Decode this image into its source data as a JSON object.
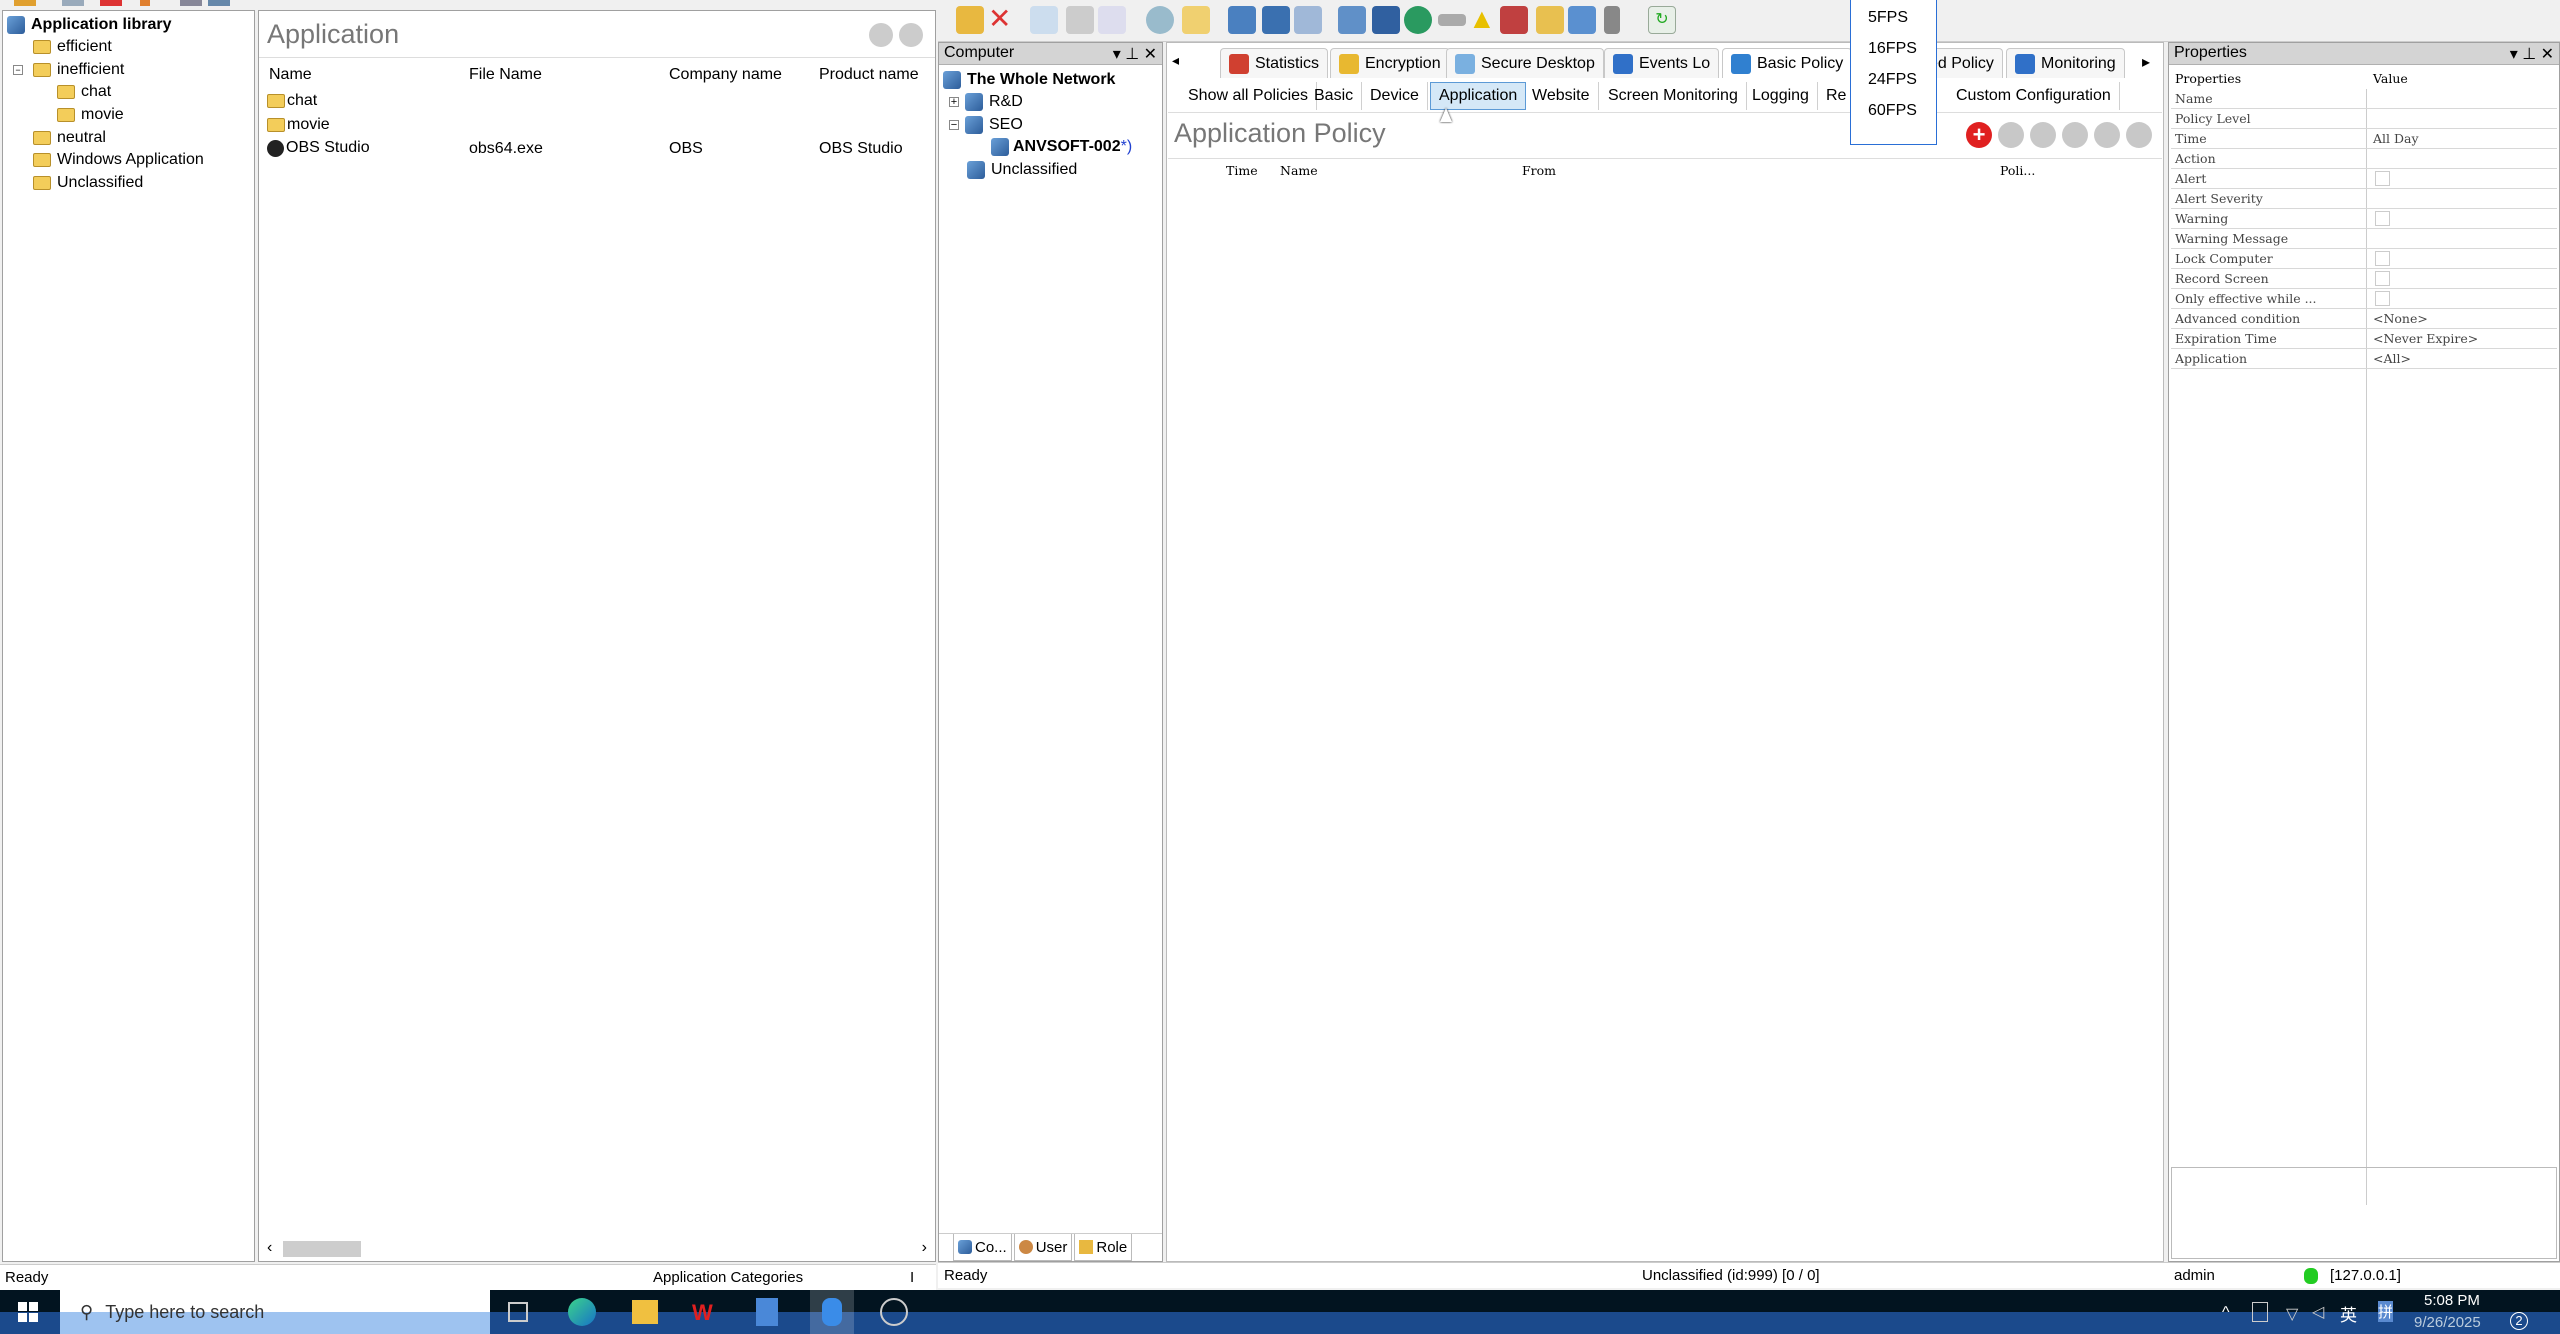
{
  "left_window": {
    "tree": {
      "root": "Application library",
      "items": [
        {
          "label": "efficient",
          "level": 1
        },
        {
          "label": "inefficient",
          "level": 1,
          "expanded": true
        },
        {
          "label": "chat",
          "level": 2
        },
        {
          "label": "movie",
          "level": 2
        },
        {
          "label": "neutral",
          "level": 1
        },
        {
          "label": "Windows Application",
          "level": 1
        },
        {
          "label": "Unclassified",
          "level": 1
        }
      ]
    },
    "panel_title": "Application",
    "columns": [
      "Name",
      "File Name",
      "Company name",
      "Product name"
    ],
    "rows": [
      {
        "name": "chat",
        "file": "",
        "company": "",
        "product": "",
        "icon": "folder"
      },
      {
        "name": "movie",
        "file": "",
        "company": "",
        "product": "",
        "icon": "folder"
      },
      {
        "name": "OBS Studio",
        "file": "obs64.exe",
        "company": "OBS",
        "product": "OBS Studio",
        "icon": "obs"
      }
    ],
    "status": {
      "left": "Ready",
      "center": "Application Categories",
      "right": "I"
    }
  },
  "fps_dropdown": {
    "options": [
      "5FPS",
      "16FPS",
      "24FPS",
      "60FPS"
    ]
  },
  "computer_panel": {
    "title": "Computer",
    "tree": [
      {
        "label": "The Whole Network",
        "level": 0
      },
      {
        "label": "R&D",
        "level": 1
      },
      {
        "label": "SEO",
        "level": 1
      },
      {
        "label": "ANVSOFT-002",
        "suffix": "*)",
        "level": 2
      },
      {
        "label": "Unclassified",
        "level": 1
      }
    ],
    "bottom_tabs": [
      "Co...",
      "User",
      "Role"
    ]
  },
  "main_tabs": [
    {
      "label": "Statistics",
      "color": "#d04030"
    },
    {
      "label": "Encryption",
      "color": "#e8b830"
    },
    {
      "label": "Secure Desktop",
      "color": "#7ab0e0"
    },
    {
      "label": "Events Lo",
      "color": "#3070c8"
    },
    {
      "label": "Basic Policy",
      "color": "#3080d0"
    },
    {
      "label": "ed Policy",
      "color": "#c0c0c0"
    },
    {
      "label": "Monitoring",
      "color": "#3070c8"
    }
  ],
  "sub_tabs": [
    "Show all Policies",
    "Basic",
    "Device",
    "Application",
    "Website",
    "Screen Monitoring",
    "Logging",
    "Re",
    "Custom Configuration"
  ],
  "active_sub_tab": "Application",
  "policy": {
    "title": "Application Policy",
    "columns": [
      "Time",
      "Name",
      "From",
      "Poli..."
    ]
  },
  "properties": {
    "title": "Properties",
    "col_property": "Properties",
    "col_value": "Value",
    "rows": [
      {
        "name": "Name",
        "value": ""
      },
      {
        "name": "Policy Level",
        "value": ""
      },
      {
        "name": "Time",
        "value": "All Day"
      },
      {
        "name": "Action",
        "value": ""
      },
      {
        "name": "Alert",
        "checkbox": true
      },
      {
        "name": "Alert Severity",
        "value": ""
      },
      {
        "name": "Warning",
        "checkbox": true
      },
      {
        "name": "Warning Message",
        "value": ""
      },
      {
        "name": "Lock Computer",
        "checkbox": true
      },
      {
        "name": "Record Screen",
        "checkbox": true
      },
      {
        "name": "Only effective while ...",
        "checkbox": true
      },
      {
        "name": "Advanced condition",
        "value": "<None>"
      },
      {
        "name": "Expiration Time",
        "value": "<Never Expire>"
      },
      {
        "name": "Application",
        "value": "<All>"
      }
    ]
  },
  "status_right": {
    "left": "Ready",
    "center": "Unclassified (id:999) [0 / 0]",
    "user": "admin",
    "server": "[127.0.0.1]"
  },
  "taskbar": {
    "search_placeholder": "Type here to search",
    "time": "5:08 PM",
    "date": "9/26/2025",
    "notifications": "2",
    "ime1": "英",
    "ime2": "拼"
  }
}
